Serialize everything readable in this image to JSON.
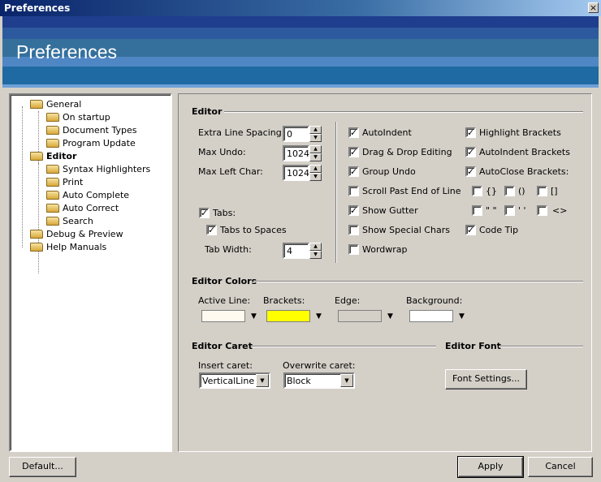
{
  "window": {
    "title": "Preferences",
    "close_glyph": "×"
  },
  "banner": {
    "title": "Preferences"
  },
  "tree": [
    {
      "label": "General",
      "bold": false
    },
    {
      "label": "On startup",
      "bold": false
    },
    {
      "label": "Document Types",
      "bold": false
    },
    {
      "label": "Program Update",
      "bold": false
    },
    {
      "label": "Editor",
      "bold": true
    },
    {
      "label": "Syntax Highlighters",
      "bold": false
    },
    {
      "label": "Print",
      "bold": false
    },
    {
      "label": "Auto Complete",
      "bold": false
    },
    {
      "label": "Auto Correct",
      "bold": false
    },
    {
      "label": "Search",
      "bold": false
    },
    {
      "label": "Debug & Preview",
      "bold": false
    },
    {
      "label": "Help Manuals",
      "bold": false
    }
  ],
  "editor": {
    "section": "Editor",
    "extra_line_spacing_label": "Extra Line Spacing:",
    "extra_line_spacing_value": "0",
    "max_undo_label": "Max Undo:",
    "max_undo_value": "1024",
    "max_left_char_label": "Max Left Char:",
    "max_left_char_value": "1024",
    "tabs_label": "Tabs:",
    "tabs_to_spaces_label": "Tabs to Spaces",
    "tab_width_label": "Tab Width:",
    "tab_width_value": "4",
    "check_mark": "✓",
    "options": {
      "autoindent": "AutoIndent",
      "drag_drop": "Drag & Drop Editing",
      "group_undo": "Group Undo",
      "scroll_past": "Scroll Past End of Line",
      "show_gutter": "Show Gutter",
      "show_special": "Show Special Chars",
      "wordwrap": "Wordwrap",
      "highlight_brackets": "Highlight Brackets",
      "autoindent_brackets": "AutoIndent Brackets",
      "autoclose_brackets": "AutoClose Brackets:",
      "code_tip": "Code Tip"
    },
    "bracket_pairs": [
      "{}",
      "()",
      "[]",
      "\" \"",
      "' '",
      "<>"
    ]
  },
  "colors": {
    "section": "Editor Colors",
    "active_line_label": "Active Line:",
    "brackets_label": "Brackets:",
    "edge_label": "Edge:",
    "background_label": "Background:",
    "active_line_color": "#fffaf0",
    "brackets_color": "#ffff00",
    "edge_color": "#d4d0c8",
    "background_color": "#ffffff"
  },
  "caret": {
    "section": "Editor Caret",
    "insert_label": "Insert caret:",
    "insert_value": "VerticalLine",
    "overwrite_label": "Overwrite caret:",
    "overwrite_value": "Block"
  },
  "font": {
    "section": "Editor Font",
    "button": "Font Settings..."
  },
  "buttons": {
    "default": "Default...",
    "apply": "Apply",
    "cancel": "Cancel"
  }
}
